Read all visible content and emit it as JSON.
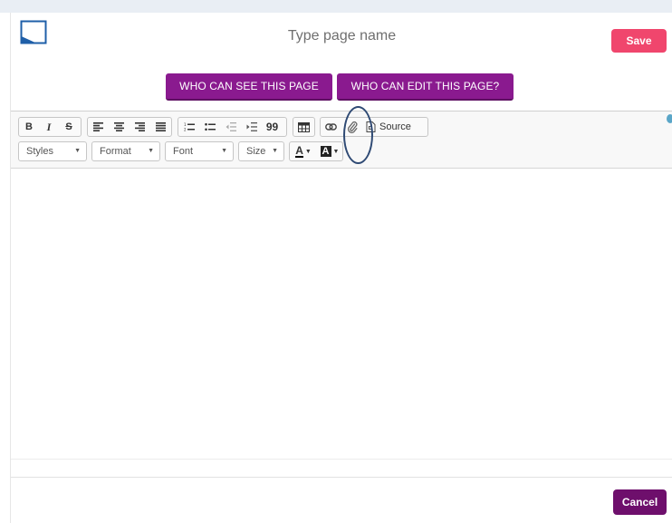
{
  "header": {
    "page_name_placeholder": "Type page name",
    "save_label": "Save"
  },
  "permissions": {
    "see_label": "WHO CAN SEE THIS PAGE",
    "edit_label": "WHO CAN EDIT THIS PAGE?"
  },
  "toolbar": {
    "bold": "B",
    "italic": "I",
    "strike": "S",
    "blockquote": "99",
    "source": "Source",
    "styles": "Styles",
    "format": "Format",
    "font": "Font",
    "size": "Size",
    "text_color": "A",
    "bg_color": "A"
  },
  "footer": {
    "cancel_label": "Cancel"
  },
  "colors": {
    "save": "#f0466d",
    "permission": "#8a1a8f",
    "cancel": "#6e0f6c",
    "highlight": "#2f4a74"
  }
}
